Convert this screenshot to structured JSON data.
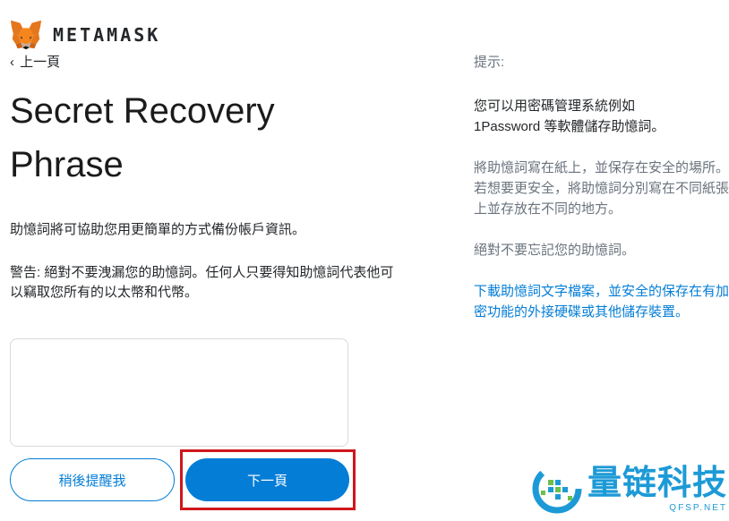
{
  "header": {
    "brand": "METAMASK",
    "logo_icon": "fox-icon",
    "back_label": "上一頁",
    "back_icon": "chevron-left-icon"
  },
  "main": {
    "title": "Secret Recovery Phrase",
    "intro": "助憶詞將可協助您用更簡單的方式備份帳戶資訊。",
    "warning": "警告: 絕對不要洩漏您的助憶詞。任何人只要得知助憶詞代表他可以竊取您所有的以太幣和代幣。",
    "seed_phrase_value": "",
    "remind_later_label": "稍後提醒我",
    "next_label": "下一頁"
  },
  "tips": {
    "heading": "提示:",
    "tip1_line1": "您可以用密碼管理系統例如",
    "tip1_line2": "1Password 等軟體儲存助憶詞。",
    "tip2": "將助憶詞寫在紙上，並保存在安全的場所。若想要更安全，將助憶詞分別寫在不同紙張上並存放在不同的地方。",
    "tip3": "絕對不要忘記您的助憶詞。",
    "download_link": "下載助憶詞文字檔案，並安全的保存在有加密功能的外接硬碟或其他儲存裝置。"
  },
  "watermark": {
    "name": "量链科技",
    "url": "QFSP.NET"
  },
  "colors": {
    "accent": "#037dd6",
    "highlight_border": "#d0161a",
    "watermark": "#1d9ad6",
    "text": "#24272a",
    "muted": "#6a737d"
  }
}
